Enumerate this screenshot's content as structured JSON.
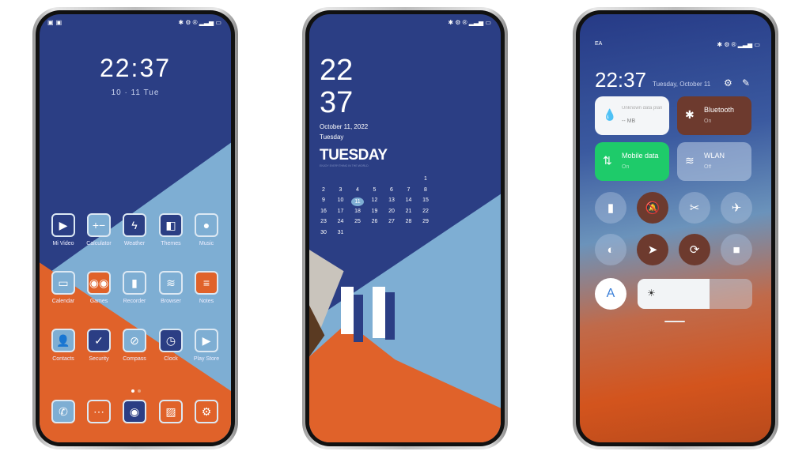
{
  "colors": {
    "dark_blue": "#2b3e84",
    "light_blue": "#7eaed3",
    "orange": "#e0622a",
    "brown": "#6d3a2e",
    "green": "#1ecb6a"
  },
  "phone1": {
    "status_icons": [
      "bluetooth-icon",
      "alarm-icon",
      "r-icon",
      "signal-icon",
      "battery-icon"
    ],
    "clock": "22:37",
    "date": "10 · 11 Tue",
    "apps": [
      {
        "label": "Mi Video",
        "glyph": "▶",
        "bg": "#2b3e84"
      },
      {
        "label": "Calculator",
        "glyph": "+−",
        "bg": "#7eaed3"
      },
      {
        "label": "Weather",
        "glyph": "ϟ",
        "bg": "#2b3e84"
      },
      {
        "label": "Themes",
        "glyph": "◧",
        "bg": "#2b3e84"
      },
      {
        "label": "Music",
        "glyph": "●",
        "bg": "#7eaed3"
      },
      {
        "label": "Calendar",
        "glyph": "▭",
        "bg": "#7eaed3"
      },
      {
        "label": "Games",
        "glyph": "◉◉",
        "bg": "#e0622a"
      },
      {
        "label": "Recorder",
        "glyph": "▮",
        "bg": "#7eaed3"
      },
      {
        "label": "Browser",
        "glyph": "≋",
        "bg": "#7eaed3"
      },
      {
        "label": "Notes",
        "glyph": "≡",
        "bg": "#e0622a"
      },
      {
        "label": "Contacts",
        "glyph": "👤",
        "bg": "#7eaed3"
      },
      {
        "label": "Security",
        "glyph": "✓",
        "bg": "#2b3e84"
      },
      {
        "label": "Compass",
        "glyph": "⊘",
        "bg": "#7eaed3"
      },
      {
        "label": "Clock",
        "glyph": "◷",
        "bg": "#2b3e84"
      },
      {
        "label": "Play Store",
        "glyph": "▶",
        "bg": "#7eaed3"
      }
    ],
    "dock": [
      {
        "name": "phone",
        "glyph": "✆",
        "bg": "#7eaed3"
      },
      {
        "name": "messages",
        "glyph": "⋯",
        "bg": "#e0622a"
      },
      {
        "name": "camera",
        "glyph": "◉",
        "bg": "#2b3e84"
      },
      {
        "name": "gallery",
        "glyph": "▨",
        "bg": "#e0622a"
      },
      {
        "name": "settings",
        "glyph": "⚙",
        "bg": "#e0622a"
      }
    ]
  },
  "phone2": {
    "hour": "22",
    "minute": "37",
    "date": "October 11, 2022",
    "weekday": "Tuesday",
    "big_day": "TUESDAY",
    "tagline": "ENJOY EVERYTHING IN THE WORLD",
    "calendar_weeks": [
      [
        null,
        null,
        null,
        null,
        null,
        null,
        1
      ],
      [
        2,
        3,
        4,
        5,
        6,
        7,
        8
      ],
      [
        9,
        10,
        11,
        12,
        13,
        14,
        15
      ],
      [
        16,
        17,
        18,
        19,
        20,
        21,
        22
      ],
      [
        23,
        24,
        25,
        26,
        27,
        28,
        29
      ],
      [
        30,
        31,
        null,
        null,
        null,
        null,
        null
      ]
    ],
    "today": 11
  },
  "phone3": {
    "carrier": "EA",
    "clock": "22:37",
    "date": "Tuesday, October 11",
    "tiles": [
      {
        "title": "Unknown data plan",
        "sub": "-- MB",
        "icon": "water-drop-icon",
        "glyph": "💧"
      },
      {
        "title": "Bluetooth",
        "sub": "On",
        "icon": "bluetooth-icon",
        "glyph": "✱"
      },
      {
        "title": "Mobile data",
        "sub": "On",
        "icon": "mobile-data-icon",
        "glyph": "⇅"
      },
      {
        "title": "WLAN",
        "sub": "Off",
        "icon": "wifi-icon",
        "glyph": "≋"
      }
    ],
    "toggles": [
      {
        "name": "flashlight",
        "glyph": "▮",
        "active": false
      },
      {
        "name": "mute",
        "glyph": "🔕",
        "active": true
      },
      {
        "name": "screenshot",
        "glyph": "✂",
        "active": false
      },
      {
        "name": "airplane-mode",
        "glyph": "✈",
        "active": false
      },
      {
        "name": "dark-mode",
        "glyph": "◐",
        "active": false
      },
      {
        "name": "location",
        "glyph": "➤",
        "active": true
      },
      {
        "name": "rotation-lock",
        "glyph": "⟳",
        "active": true
      },
      {
        "name": "screen-recorder",
        "glyph": "■",
        "active": false
      }
    ],
    "auto_brightness_label": "A",
    "brightness_percent": 63
  }
}
